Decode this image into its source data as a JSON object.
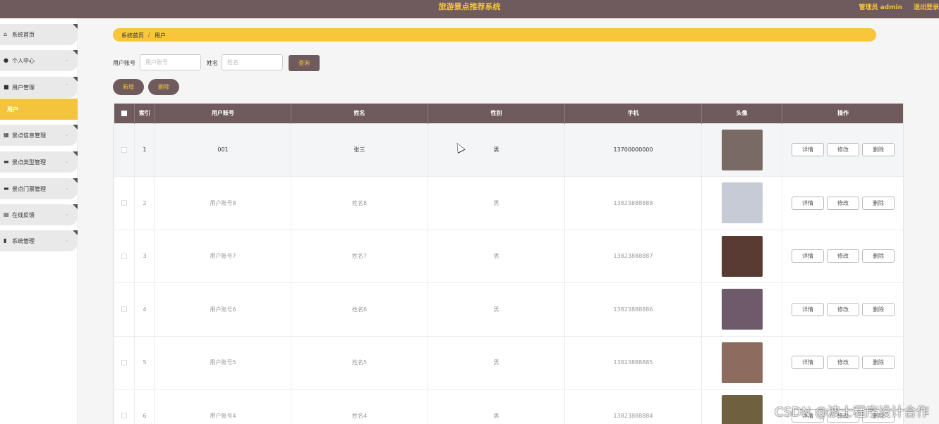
{
  "header": {
    "title": "旅游景点推荐系统",
    "user_label": "管理员 admin",
    "logout_label": "退出登录"
  },
  "sidebar": {
    "items": [
      {
        "label": "系统首页",
        "icon": "home-icon"
      },
      {
        "label": "个人中心",
        "icon": "user-icon",
        "expandable": true
      },
      {
        "label": "用户管理",
        "icon": "user-manage-icon",
        "expandable": true,
        "expanded": true
      },
      {
        "label": "用户",
        "active": true
      },
      {
        "label": "景点信息管理",
        "icon": "grid-icon",
        "expandable": true
      },
      {
        "label": "景点类型管理",
        "icon": "briefcase-icon",
        "expandable": true
      },
      {
        "label": "景点门票管理",
        "icon": "ticket-icon",
        "expandable": true
      },
      {
        "label": "在线反馈",
        "icon": "clipboard-icon",
        "expandable": true
      },
      {
        "label": "系统管理",
        "icon": "bar-chart-icon",
        "expandable": true
      }
    ]
  },
  "breadcrumb": {
    "home": "系统首页",
    "separator": "/",
    "current": "用户"
  },
  "search": {
    "account_label": "用户账号",
    "account_placeholder": "用户账号",
    "name_label": "姓名",
    "name_placeholder": "姓名",
    "query_button": "查询"
  },
  "actions": {
    "add_button": "新增",
    "delete_button": "删除"
  },
  "table": {
    "headers": [
      "索引",
      "用户账号",
      "姓名",
      "性别",
      "手机",
      "头像",
      "操作"
    ],
    "op_labels": {
      "detail": "详情",
      "edit": "修改",
      "delete": "删除"
    },
    "rows": [
      {
        "index": "1",
        "account": "001",
        "name": "张三",
        "gender": "男",
        "phone": "13700000000",
        "avatar_color": "#7a6a66"
      },
      {
        "index": "2",
        "account": "用户账号8",
        "name": "姓名8",
        "gender": "男",
        "phone": "13823888888",
        "avatar_color": "#c7cbd6"
      },
      {
        "index": "3",
        "account": "用户账号7",
        "name": "姓名7",
        "gender": "男",
        "phone": "13823888887",
        "avatar_color": "#5a3b33"
      },
      {
        "index": "4",
        "account": "用户账号6",
        "name": "姓名6",
        "gender": "男",
        "phone": "13823888886",
        "avatar_color": "#6e5a6a"
      },
      {
        "index": "5",
        "account": "用户账号5",
        "name": "姓名5",
        "gender": "男",
        "phone": "13823888885",
        "avatar_color": "#8d6b5e"
      },
      {
        "index": "6",
        "account": "用户账号4",
        "name": "姓名4",
        "gender": "男",
        "phone": "13823888884",
        "avatar_color": "#6f6040"
      }
    ]
  },
  "colors": {
    "header_bg": "#6f5b5e",
    "accent": "#f4c43c",
    "breadcrumb_bg": "#f8c53b"
  },
  "watermark": "CSDN @波士程序设计合作"
}
